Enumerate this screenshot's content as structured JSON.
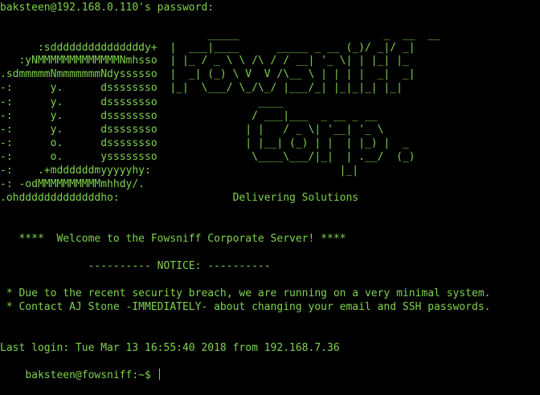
{
  "colors": {
    "background": "#000000",
    "text": "#7fd34e"
  },
  "terminal": {
    "password_prompt": "baksteen@192.168.0.110's password:",
    "banner": [
      "                                 _____                       _  __  __ ",
      "      :sdddddddddddddddy+  |  ___|____      _____ _ __ (_)/ _|/ _|",
      "   :yNMMMMMMMMMMMMMNmhsso  | |_ / _ \\ \\ /\\ / / __| '_ \\| | |_| |_ ",
      ".sdmmmmmNmmmmmmmNdyssssso  |  _| (_) \\ V  V /\\__ \\ | | | |  _|  _|",
      "-:      y.      dssssssso  |_|  \\___/ \\_/\\_/ |___/_| |_|_|_| |_|  ",
      "-:      y.      dssssssso                ____                      ",
      "-:      y.      dssssssso               / ___|___  _ __ _ __       ",
      "-:      y.      dssssssso              | |   / _ \\| '__| '_ \\      ",
      "-:      o.      dssssssso              | |__| (_) | |  | |_) |  _  ",
      "-:      o.      yssssssso               \\____\\___/|_|  | .__/  (_) ",
      "-:    .+mddddddmyyyyyhy:                              |_|          ",
      "-: -odMMMMMMMMMMmhhdy/.                                            ",
      ".ohdddddddddddddho:                  Delivering Solutions"
    ],
    "welcome": "   ****  Welcome to the Fowsniff Corporate Server! ****",
    "notice_header": "              ---------- NOTICE: ----------",
    "notices": [
      " * Due to the recent security breach, we are running on a very minimal system.",
      " * Contact AJ Stone -IMMEDIATELY- about changing your email and SSH passwords."
    ],
    "last_login": "Last login: Tue Mar 13 16:55:40 2018 from 192.168.7.36",
    "shell_prompt": "baksteen@fowsniff:~$ "
  }
}
